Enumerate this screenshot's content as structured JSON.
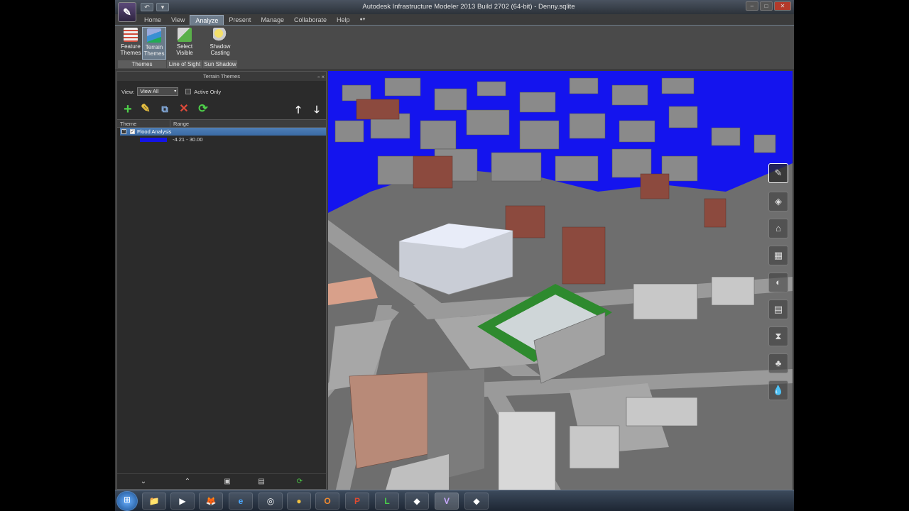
{
  "window": {
    "title": "Autodesk Infrastructure Modeler 2013  Build 2702 (64-bit) - Denny.sqlite",
    "app_button": "✎",
    "quick_access": [
      "↶",
      "▾"
    ],
    "controls": [
      "–",
      "□",
      "✕"
    ]
  },
  "ribbon": {
    "tabs": [
      "Home",
      "View",
      "Analyze",
      "Present",
      "Manage",
      "Collaborate",
      "Help"
    ],
    "extra_tab": "●▾",
    "active_tab": "Analyze",
    "buttons": [
      {
        "label1": "Feature",
        "label2": "Themes",
        "icon": "feature-themes-icon",
        "color": "#d24b3a"
      },
      {
        "label1": "Terrain",
        "label2": "Themes",
        "icon": "terrain-themes-icon",
        "color": "#3a8fd2"
      },
      {
        "label1": "Select",
        "label2": "Visible",
        "icon": "select-visible-icon",
        "color": "#5ab04a"
      },
      {
        "label1": "Shadow",
        "label2": "Casting",
        "icon": "shadow-casting-icon",
        "color": "#e8c84a"
      }
    ],
    "groups": [
      "Themes",
      "Line of Sight",
      "Sun Shadow"
    ]
  },
  "panel": {
    "title": "Terrain Themes",
    "pin": "▫ ×",
    "view_label": "View:",
    "view_value": "View All",
    "view_arrow": "▾",
    "active_only_label": "Active Only",
    "tools": {
      "add": "+",
      "edit": "✎",
      "duplicate": "⧉",
      "delete": "✕",
      "refresh": "⟳",
      "up": "🡑",
      "down": "🡓"
    },
    "columns": [
      "Theme",
      "Range"
    ],
    "rows": [
      {
        "name": "Flood Analysis",
        "expander": "−",
        "check": "✓",
        "range_label": "-4.21 - 30.00",
        "swatch": "#1414e6"
      }
    ],
    "footer": [
      "⌄",
      "⌃",
      "▣",
      "▤",
      "⟳"
    ]
  },
  "navigation": {
    "icons": [
      "✎",
      "◈",
      "⌂",
      "▦",
      "◐",
      "▤",
      "⧗",
      "♣",
      "💧"
    ]
  },
  "taskbar": {
    "start": "⊞",
    "items": [
      "📁",
      "▶",
      "🦊",
      "e",
      "◎",
      "●",
      "O",
      "P",
      "L",
      "◆",
      "V",
      "◆"
    ]
  },
  "colors": {
    "water": "#1414ee",
    "selection": "#4f7fb6",
    "panel_bg": "#2b2b2b"
  }
}
